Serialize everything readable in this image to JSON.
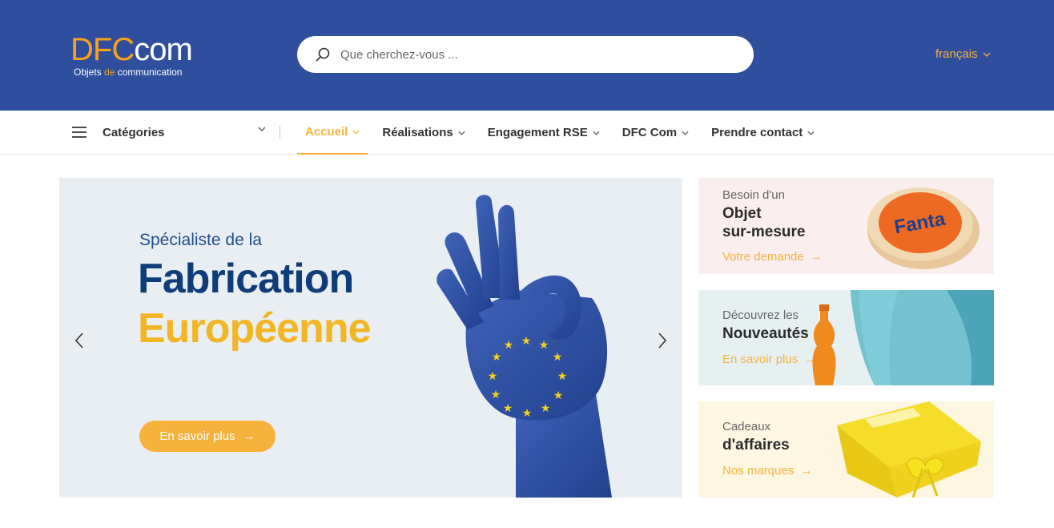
{
  "brand": {
    "logo_dfc": "DFC",
    "logo_com": "com",
    "tagline_a": "Objets ",
    "tagline_de": "de",
    "tagline_b": " communication",
    "accent": "#f7a21b",
    "header_bg": "#2f4e9e"
  },
  "search": {
    "placeholder": "Que cherchez-vous ...",
    "value": "",
    "icon": "search-icon"
  },
  "language": {
    "label": "français"
  },
  "nav": {
    "categories_label": "Catégories",
    "items": [
      {
        "label": "Accueil",
        "active": true
      },
      {
        "label": "Réalisations",
        "active": false
      },
      {
        "label": "Engagement RSE",
        "active": false
      },
      {
        "label": "DFC Com",
        "active": false
      },
      {
        "label": "Prendre contact",
        "active": false
      }
    ]
  },
  "hero": {
    "kicker": "Spécialiste de la",
    "title_line1": "Fabrication",
    "title_line2": "Européenne",
    "button_label": "En savoir plus",
    "arrow": "→"
  },
  "cards": [
    {
      "kicker": "Besoin d'un",
      "title_line1": "Objet",
      "title_line2": "sur-mesure",
      "link": "Votre demande",
      "bg": "#fbeeee"
    },
    {
      "kicker": "Découvrez les",
      "title_line1": "Nouveautés",
      "title_line2": "",
      "link": "En savoir plus",
      "bg": "#e7f0f1"
    },
    {
      "kicker": "Cadeaux",
      "title_line1": "d'affaires",
      "title_line2": "",
      "link": "Nos marques",
      "bg": "#fdf6e1"
    }
  ],
  "product_badge": {
    "text": "Fanta"
  }
}
